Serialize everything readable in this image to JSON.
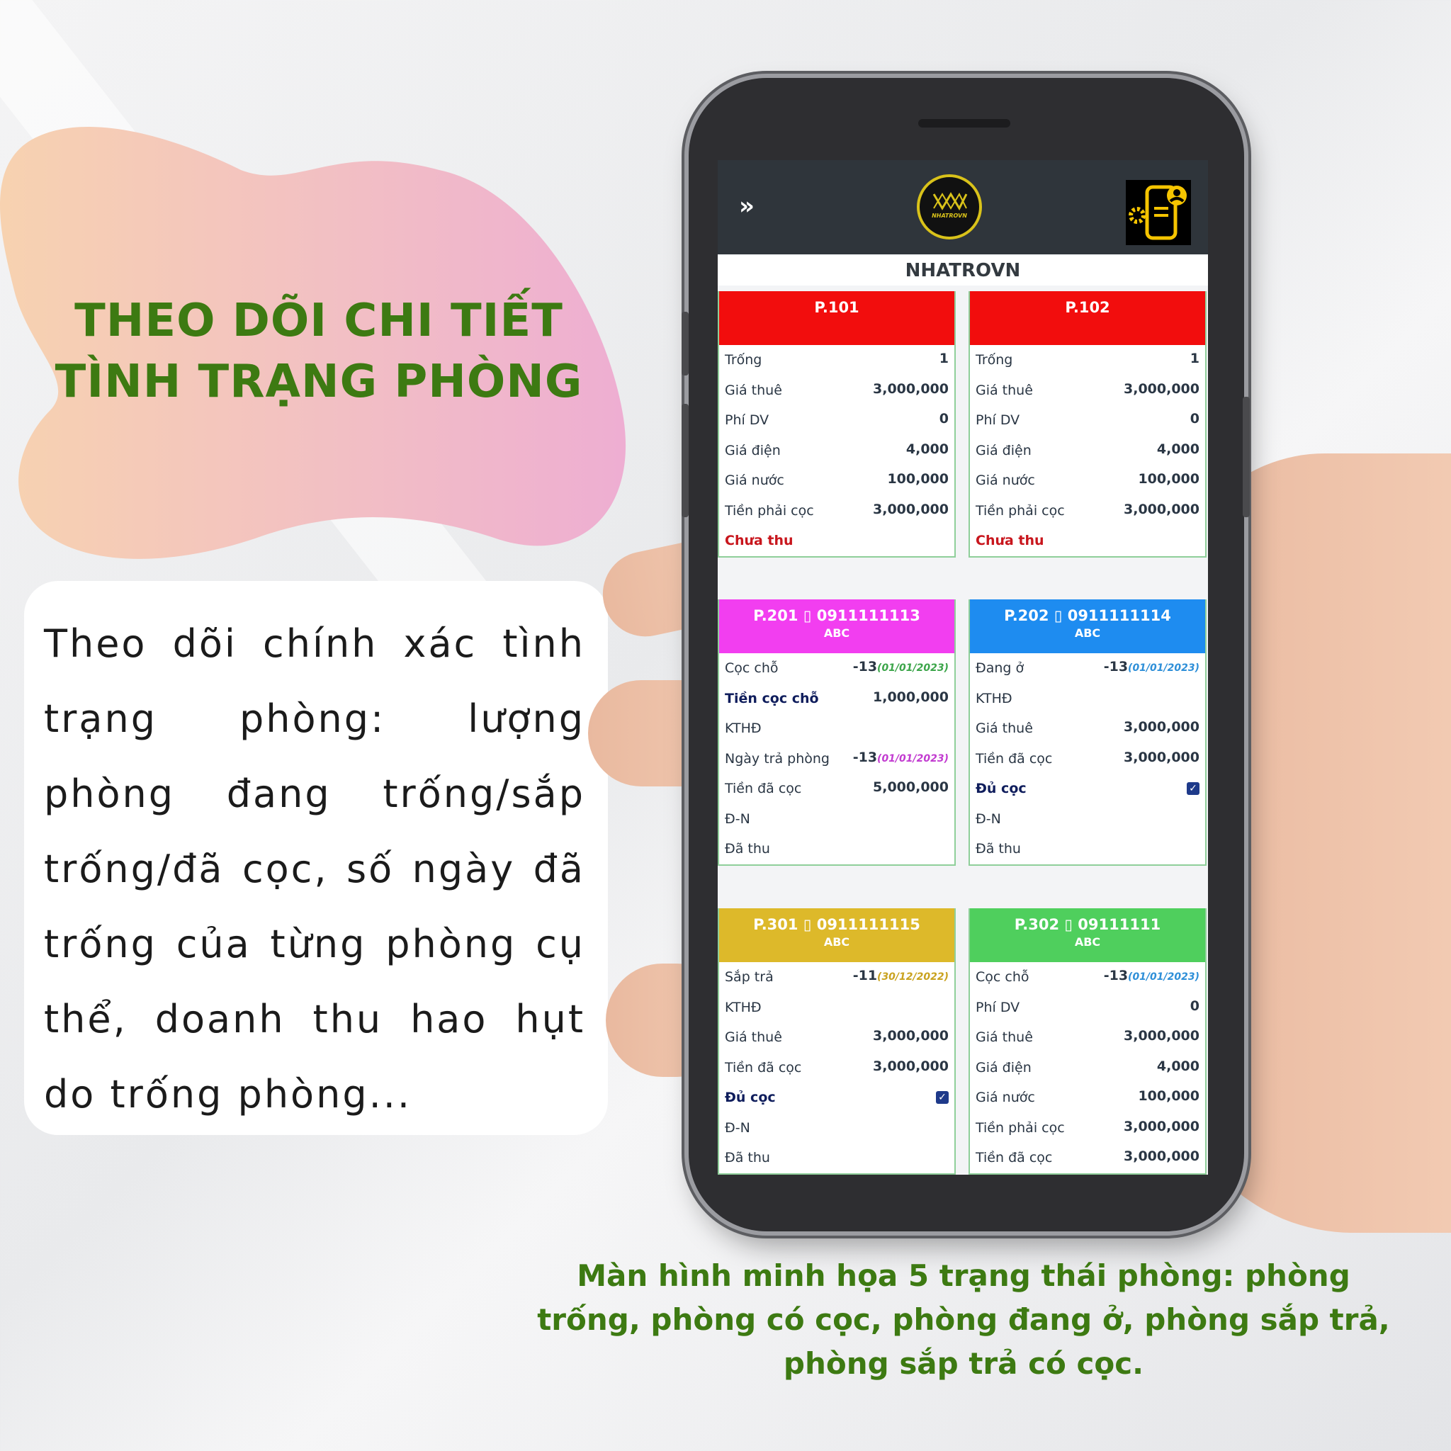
{
  "headline": {
    "line1": "THEO DÕI CHI TIẾT",
    "line2": "TÌNH TRẠNG PHÒNG"
  },
  "description": "Theo dõi chính xác tình trạng phòng: lượng phòng đang trống/sắp trống/đã cọc, số ngày đã trống của từng phòng cụ thể, doanh thu hao hụt do trống phòng...",
  "caption": {
    "line1": "Màn hình minh họa 5 trạng thái phòng: phòng",
    "line2": "trống, phòng có cọc, phòng đang ở, phòng sắp trả,",
    "line3": "phòng sắp trả có cọc."
  },
  "app": {
    "menu_icon": "»",
    "logo_text": "NHATROVN",
    "title": "NHATROVN",
    "support_icon": "phone-support-icon"
  },
  "colors": {
    "red": "#f20d0d",
    "magenta": "#f23ef0",
    "blue": "#1e8cf0",
    "yellow": "#ddb92a",
    "green": "#4fcf5d"
  },
  "rooms": [
    {
      "name": "P.101",
      "rows": [
        {
          "label": "Trống",
          "value": "1"
        },
        {
          "label": "Giá thuê",
          "value": "3,000,000"
        },
        {
          "label": "Phí DV",
          "value": "0"
        },
        {
          "label": "Giá điện",
          "value": "4,000"
        },
        {
          "label": "Giá nước",
          "value": "100,000"
        },
        {
          "label": "Tiền phải cọc",
          "value": "3,000,000"
        },
        {
          "label": "Chưa thu",
          "value": ""
        }
      ]
    },
    {
      "name": "P.102",
      "rows": [
        {
          "label": "Trống",
          "value": "1"
        },
        {
          "label": "Giá thuê",
          "value": "3,000,000"
        },
        {
          "label": "Phí DV",
          "value": "0"
        },
        {
          "label": "Giá điện",
          "value": "4,000"
        },
        {
          "label": "Giá nước",
          "value": "100,000"
        },
        {
          "label": "Tiền phải cọc",
          "value": "3,000,000"
        },
        {
          "label": "Chưa thu",
          "value": ""
        }
      ]
    },
    {
      "name": "P.201",
      "phone": "0911111113",
      "tenant": "ABC",
      "rows": [
        {
          "label": "Cọc chỗ",
          "value": "-13",
          "date": "(01/01/2023)"
        },
        {
          "label": "Tiền cọc chỗ",
          "value": "1,000,000"
        },
        {
          "label": "KTHĐ",
          "value": ""
        },
        {
          "label": "Ngày trả phòng",
          "value": "-13",
          "date": "(01/01/2023)"
        },
        {
          "label": "Tiền đã cọc",
          "value": "5,000,000"
        },
        {
          "label": "Đ-N",
          "value": ""
        },
        {
          "label": "Đã thu",
          "value": ""
        }
      ]
    },
    {
      "name": "P.202",
      "phone": "0911111114",
      "tenant": "ABC",
      "rows": [
        {
          "label": "Đang ở",
          "value": "-13",
          "date": "(01/01/2023)"
        },
        {
          "label": "KTHĐ",
          "value": ""
        },
        {
          "label": "Giá thuê",
          "value": "3,000,000"
        },
        {
          "label": "Tiền đã cọc",
          "value": "3,000,000"
        },
        {
          "label": "Đủ cọc",
          "value": "✓"
        },
        {
          "label": "Đ-N",
          "value": ""
        },
        {
          "label": "Đã thu",
          "value": ""
        }
      ]
    },
    {
      "name": "P.301",
      "phone": "0911111115",
      "tenant": "ABC",
      "rows": [
        {
          "label": "Sắp trả",
          "value": "-11",
          "date": "(30/12/2022)"
        },
        {
          "label": "KTHĐ",
          "value": ""
        },
        {
          "label": "Giá thuê",
          "value": "3,000,000"
        },
        {
          "label": "Tiền đã cọc",
          "value": "3,000,000"
        },
        {
          "label": "Đủ cọc",
          "value": "✓"
        },
        {
          "label": "Đ-N",
          "value": ""
        },
        {
          "label": "Đã thu",
          "value": ""
        }
      ]
    },
    {
      "name": "P.302",
      "phone": "09111111",
      "tenant": "ABC",
      "rows": [
        {
          "label": "Cọc chỗ",
          "value": "-13",
          "date": "(01/01/2023)"
        },
        {
          "label": "Phí DV",
          "value": "0"
        },
        {
          "label": "Giá thuê",
          "value": "3,000,000"
        },
        {
          "label": "Giá điện",
          "value": "4,000"
        },
        {
          "label": "Giá nước",
          "value": "100,000"
        },
        {
          "label": "Tiền phải cọc",
          "value": "3,000,000"
        },
        {
          "label": "Tiền đã cọc",
          "value": "3,000,000"
        }
      ]
    }
  ]
}
